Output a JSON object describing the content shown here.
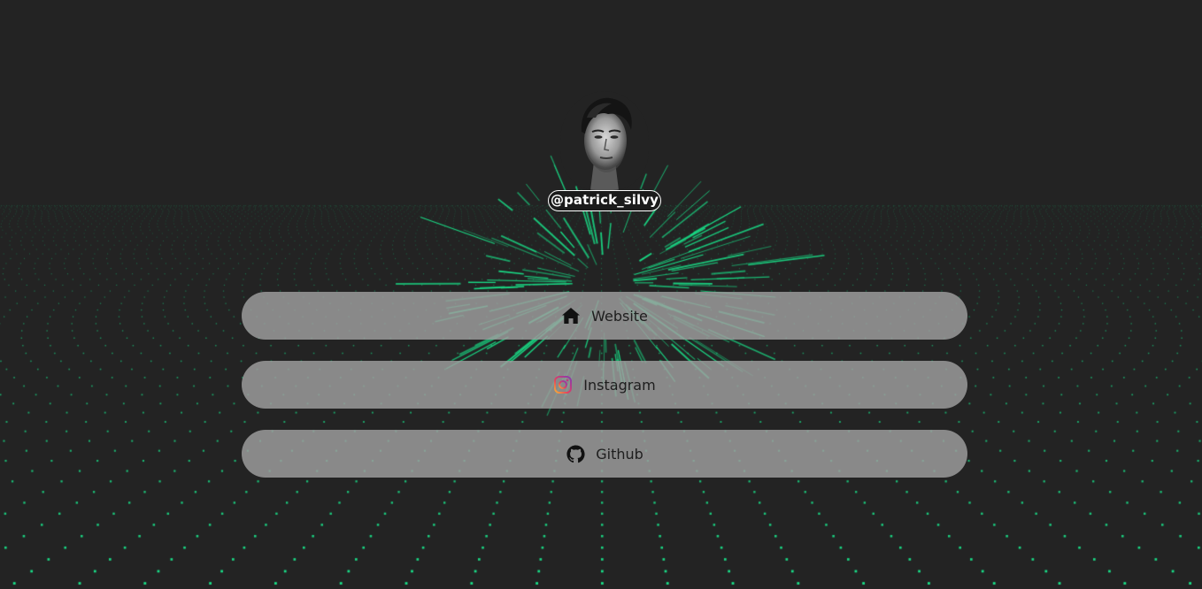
{
  "profile": {
    "handle": "@patrick_silvy"
  },
  "links": [
    {
      "label": "Website",
      "icon": "home-icon"
    },
    {
      "label": "Instagram",
      "icon": "instagram-icon"
    },
    {
      "label": "Github",
      "icon": "github-icon"
    }
  ],
  "colors": {
    "background": "#232323",
    "particle": "#19e38a",
    "button": "#a0a0a0",
    "button_text": "#1e1e1e"
  }
}
